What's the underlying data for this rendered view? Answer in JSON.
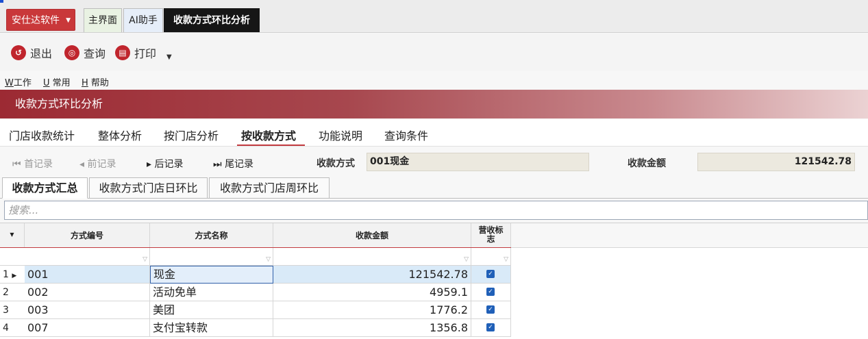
{
  "topbar": {
    "brand_label": "安仕达软件",
    "tabs": [
      {
        "label": "主界面"
      },
      {
        "label": "AI助手"
      },
      {
        "label": "收款方式环比分析"
      }
    ]
  },
  "toolbar": {
    "exit_label": "退出",
    "query_label": "查询",
    "print_label": "打印"
  },
  "menu": {
    "items": [
      {
        "key": "W",
        "label": "工作"
      },
      {
        "key": "U",
        "label": "常用"
      },
      {
        "key": "H",
        "label": "帮助"
      }
    ]
  },
  "banner": {
    "title": "收款方式环比分析"
  },
  "module_tabs": [
    {
      "label": "门店收款统计"
    },
    {
      "label": "整体分析"
    },
    {
      "label": "按门店分析"
    },
    {
      "label": "按收款方式"
    },
    {
      "label": "功能说明"
    },
    {
      "label": "查询条件"
    }
  ],
  "record_nav": {
    "first": "首记录",
    "prev": "前记录",
    "next": "后记录",
    "last": "尾记录",
    "method_label": "收款方式",
    "method_value": "001现金",
    "amount_label": "收款金额",
    "amount_value": "121542.78"
  },
  "sub_tabs": [
    {
      "label": "收款方式汇总"
    },
    {
      "label": "收款方式门店日环比"
    },
    {
      "label": "收款方式门店周环比"
    }
  ],
  "search": {
    "placeholder": "搜索..."
  },
  "grid": {
    "headers": [
      "方式编号",
      "方式名称",
      "收款金额",
      "营收标志"
    ],
    "rows": [
      {
        "n": "1",
        "code": "001",
        "name": "现金",
        "amount": "121542.78",
        "flag": true
      },
      {
        "n": "2",
        "code": "002",
        "name": "活动免单",
        "amount": "4959.1",
        "flag": true
      },
      {
        "n": "3",
        "code": "003",
        "name": "美团",
        "amount": "1776.2",
        "flag": true
      },
      {
        "n": "4",
        "code": "007",
        "name": "支付宝转款",
        "amount": "1356.8",
        "flag": true
      }
    ]
  }
}
